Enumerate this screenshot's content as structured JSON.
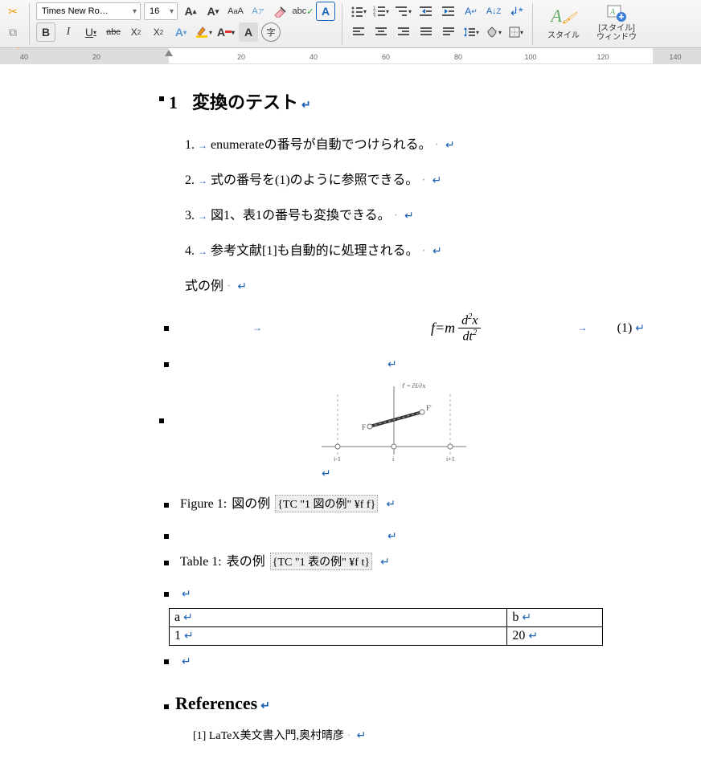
{
  "toolbar": {
    "font_name": "Times New Ro…",
    "font_size": "16",
    "styles_label": "スタイル",
    "styles_window_label": "[スタイル]\nウィンドウ"
  },
  "ruler": {
    "labels": [
      "40",
      "20",
      "20",
      "40",
      "60",
      "80",
      "100",
      "120",
      "140"
    ]
  },
  "doc": {
    "heading_num": "1",
    "heading_text": "変換のテスト",
    "list": [
      {
        "n": "1.",
        "txt": "enumerateの番号が自動でつけられる。"
      },
      {
        "n": "2.",
        "txt": "式の番号を(1)のように参照できる。"
      },
      {
        "n": "3.",
        "txt": "図1、表1の番号も変換できる。"
      },
      {
        "n": "4.",
        "txt": "参考文献[1]も自動的に処理される。"
      }
    ],
    "subhead": "式の例",
    "equation": {
      "lhs": "f=m",
      "num_a": "d",
      "num_b": "x",
      "den_a": "dt",
      "eqnum": "(1)"
    },
    "figure_caption_label": "Figure 1:",
    "figure_caption_text": "図の例",
    "figure_fieldcode": "{TC \"1  図の例\" ¥f f}",
    "table_caption_label": "Table 1:",
    "table_caption_text": "表の例",
    "table_fieldcode": "{TC \"1  表の例\" ¥f t}",
    "table": {
      "headers": [
        "a",
        "b"
      ],
      "row": [
        "1",
        "20"
      ]
    },
    "refs_heading": "References",
    "ref_item": "[1] LaTeX美文書入門,奥村晴彦",
    "figure_annot": {
      "f": "F",
      "fprime": "F'",
      "derivative": "f' = ∂f/∂x",
      "im1": "i-1",
      "i": "i",
      "ip1": "i+1"
    }
  }
}
